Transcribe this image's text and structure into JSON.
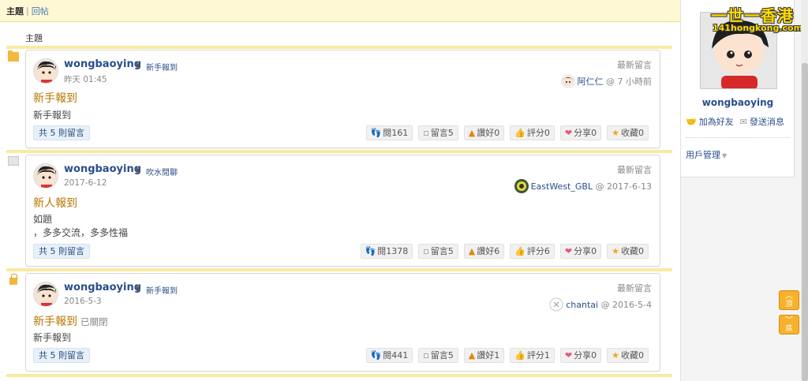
{
  "tabs": {
    "active": "主題",
    "separator": "|",
    "other": "回帖"
  },
  "column_header": "主題",
  "posts": [
    {
      "author": "wongbaoying",
      "forum": "新手報到",
      "date": "昨天 01:45",
      "latest_label": "最新留言",
      "latest_user": "阿仁仁",
      "latest_time": "@ 7 小時前",
      "title": "新手報到",
      "closed_label": "",
      "body_lines": [
        "新手報到"
      ],
      "replies": "共 5 則留言",
      "views": "閱161",
      "replies_count": "留言5",
      "likes": "讚好0",
      "rating": "評分0",
      "shares": "分享0",
      "favorites": "收藏0"
    },
    {
      "author": "wongbaoying",
      "forum": "吹水閒聊",
      "date": "2017-6-12",
      "latest_label": "最新留言",
      "latest_user": "EastWest_GBL",
      "latest_time": "@ 2017-6-13",
      "title": "新人報到",
      "closed_label": "",
      "body_lines": [
        "如題",
        "，多多交流，多多性福"
      ],
      "replies": "共 5 則留言",
      "views": "閱1378",
      "replies_count": "留言5",
      "likes": "讚好6",
      "rating": "評分6",
      "shares": "分享0",
      "favorites": "收藏0"
    },
    {
      "author": "wongbaoying",
      "forum": "新手報到",
      "date": "2016-5-3",
      "latest_label": "最新留言",
      "latest_user": "chantai",
      "latest_time": "@ 2016-5-4",
      "title": "新手報到",
      "closed_label": "已關閉",
      "body_lines": [
        "新手報到"
      ],
      "replies": "共 5 則留言",
      "views": "閱441",
      "replies_count": "留言5",
      "likes": "讚好1",
      "rating": "評分1",
      "shares": "分享0",
      "favorites": "收藏0"
    }
  ],
  "sidebar": {
    "logo_text": "一世一香港",
    "logo_url_text": "141hongkong.com",
    "username": "wongbaoying",
    "add_friend": "加為好友",
    "send_message": "發送消息",
    "user_management": "用戶管理",
    "top_button": "頂",
    "bottom_button": "底"
  },
  "colors": {
    "link": "#2a4e8a",
    "title": "#b57700",
    "band": "#fbe9a3",
    "logo_yellow": "#ffdb00",
    "float_button": "#f7b22c"
  }
}
